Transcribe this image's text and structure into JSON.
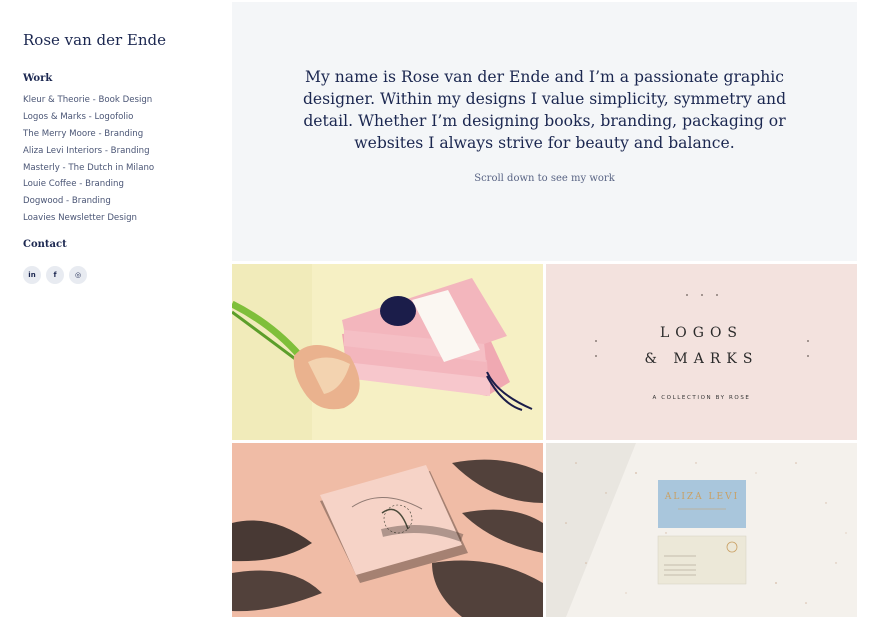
{
  "sidebar": {
    "title": "Rose van der Ende",
    "work_label": "Work",
    "contact_label": "Contact",
    "items": [
      {
        "label": "Kleur & Theorie - Book Design"
      },
      {
        "label": "Logos & Marks - Logofolio"
      },
      {
        "label": "The Merry Moore - Branding"
      },
      {
        "label": "Aliza Levi Interiors - Branding"
      },
      {
        "label": "Masterly - The Dutch in Milano"
      },
      {
        "label": "Louie Coffee - Branding"
      },
      {
        "label": "Dogwood - Branding"
      },
      {
        "label": "Loavies Newsletter Design"
      }
    ],
    "socials": [
      {
        "label": "in",
        "icon": "linkedin-icon"
      },
      {
        "label": "f",
        "icon": "facebook-icon"
      },
      {
        "label": "◎",
        "icon": "instagram-icon"
      }
    ]
  },
  "hero": {
    "text": "My name is Rose van der Ende and I’m a passionate graphic designer. Within my designs I value simplicity,  symmetry and detail. Whether I’m designing books, branding, packaging or websites I always strive for beauty and balance.",
    "scroll_label": "Scroll down to see my work"
  },
  "tiles": {
    "logos": {
      "line1": "LOGOS",
      "line2": "& MARKS",
      "sub": "A COLLECTION BY ROSE"
    },
    "card": {
      "brand": "ALIZA LEVI"
    }
  },
  "colors": {
    "navy": "#1b2750",
    "hero_bg": "#f4f6f8",
    "book_pink": "#f3b6bd",
    "tile_pink": "#f3e2de"
  }
}
